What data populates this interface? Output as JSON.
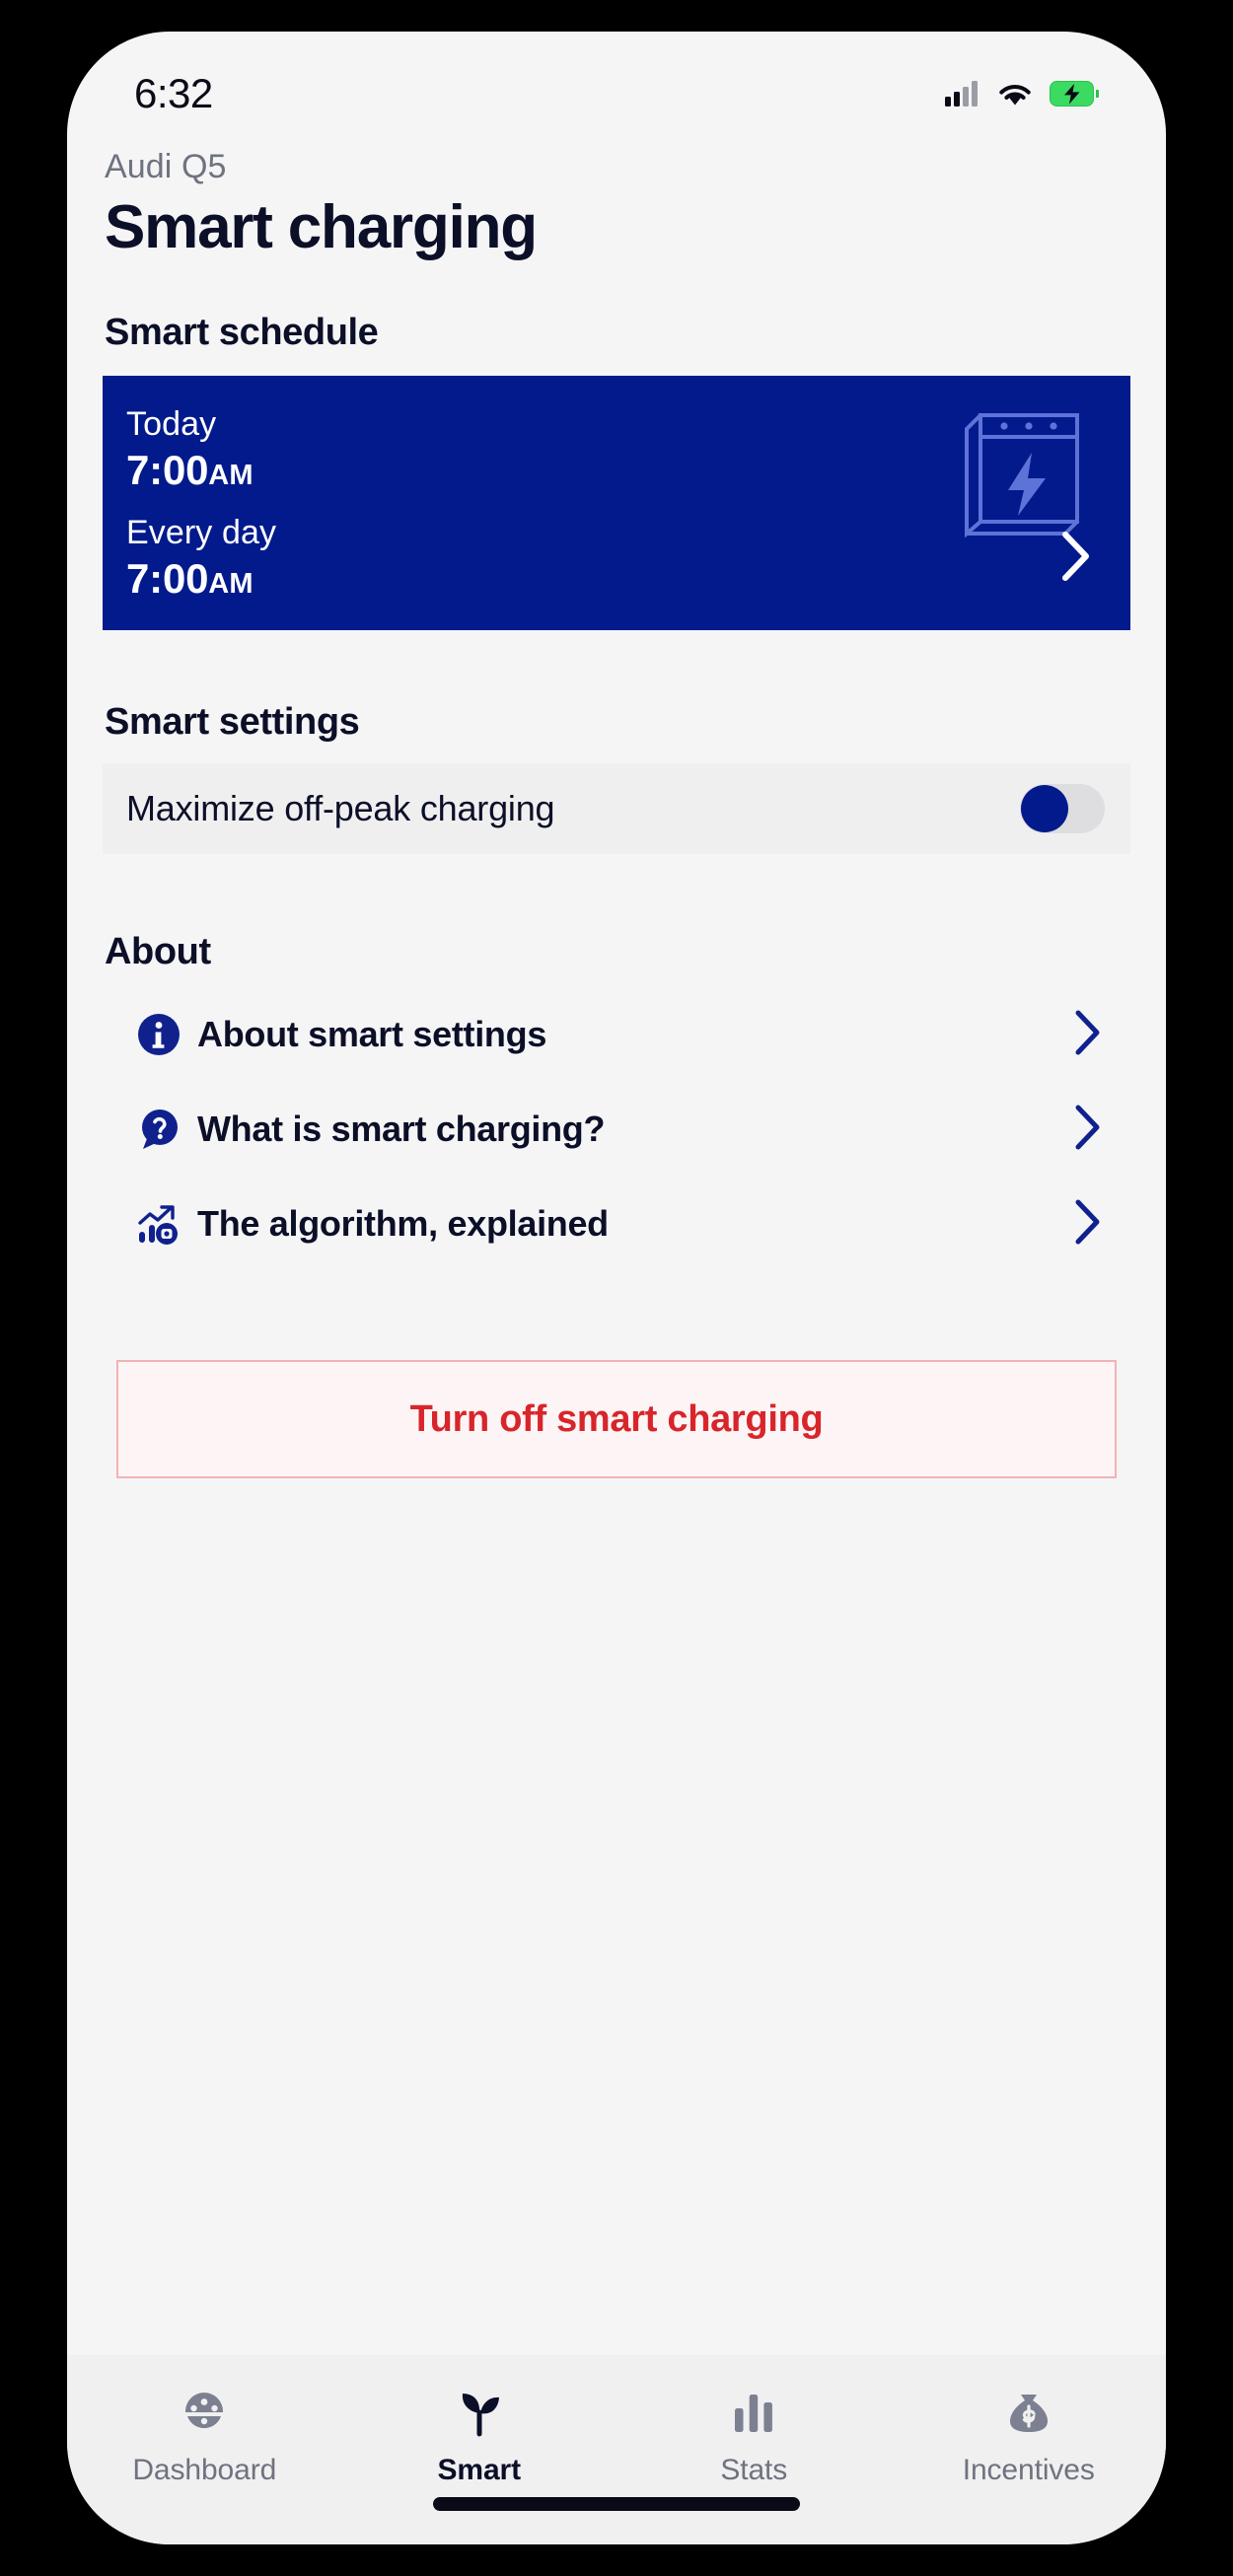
{
  "status_bar": {
    "time": "6:32",
    "signal_icon": "cellular-signal-icon",
    "wifi_icon": "wifi-icon",
    "battery_icon": "battery-charging-icon",
    "battery_color": "#3BDA60"
  },
  "header": {
    "vehicle": "Audi Q5",
    "title": "Smart charging"
  },
  "smart_schedule": {
    "heading": "Smart schedule",
    "card": {
      "today_label": "Today",
      "today_time": "7:00",
      "today_meridiem": "AM",
      "repeat_label": "Every day",
      "repeat_time": "7:00",
      "repeat_meridiem": "AM",
      "illustration_icon": "calendar-bolt-icon",
      "chevron_icon": "chevron-right-icon",
      "background_color": "#031A8C"
    }
  },
  "smart_settings": {
    "heading": "Smart settings",
    "rows": [
      {
        "label": "Maximize off-peak charging",
        "toggle_state": "off",
        "knob_color": "#031A8C",
        "track_color": "#DEDEE1"
      }
    ]
  },
  "about": {
    "heading": "About",
    "items": [
      {
        "label": "About smart settings",
        "icon": "info-circle-icon",
        "chevron": "chevron-right-icon"
      },
      {
        "label": "What is smart charging?",
        "icon": "question-bubble-icon",
        "chevron": "chevron-right-icon"
      },
      {
        "label": "The algorithm, explained",
        "icon": "chart-algorithm-icon",
        "chevron": "chevron-right-icon"
      }
    ]
  },
  "danger_action": {
    "label": "Turn off smart charging",
    "text_color": "#D8252B",
    "border_color": "#F2B3B3",
    "background_color": "#FDF5F5"
  },
  "tab_bar": {
    "items": [
      {
        "label": "Dashboard",
        "icon": "dashboard-gauge-icon",
        "active": false
      },
      {
        "label": "Smart",
        "icon": "sprout-leaf-icon",
        "active": true
      },
      {
        "label": "Stats",
        "icon": "bar-chart-icon",
        "active": false
      },
      {
        "label": "Incentives",
        "icon": "money-bag-icon",
        "active": false
      }
    ]
  },
  "accent_color": "#031A8C"
}
